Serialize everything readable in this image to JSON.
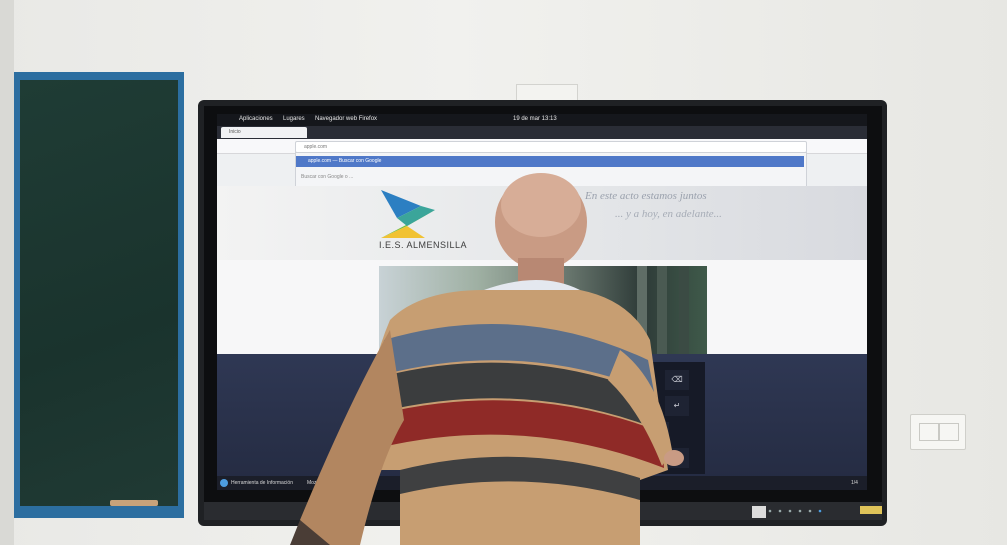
{
  "screen": {
    "topbar": {
      "menu_apps": "Aplicaciones",
      "menu_places": "Lugares",
      "menu_browser": "Navegador web Firefox",
      "clock": "19 de mar 13:13"
    },
    "tab_label": "Inicio",
    "url_value": "apple.com",
    "dropdown_item": "apple.com — Buscar con Google",
    "dropdown_search": "Buscar con Google o ...",
    "logo_text": "I.E.S. ALMENSILLA",
    "slogan_line1": "En este acto estamos juntos",
    "slogan_line2": "... y a hoy, en adelante...",
    "taskbar_item1": "Herramienta de Información",
    "taskbar_item2": "Mozilla Firefox",
    "taskbar_page": "1/4"
  },
  "colors": {
    "board_frame": "#2c6ea0",
    "board_surface": "#1f3c35",
    "screen_navy": "#2f3854",
    "dropdown_highlight": "#4f78c8"
  }
}
